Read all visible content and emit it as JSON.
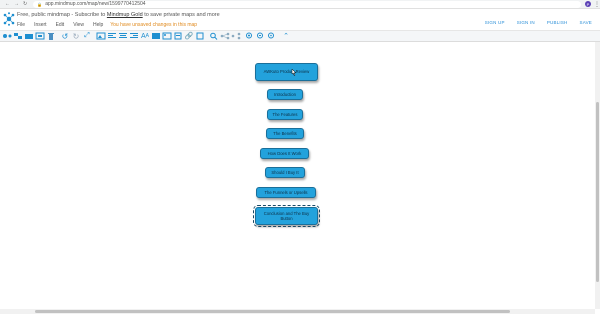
{
  "browser": {
    "url": "app.mindmup.com/map/new/1599770412504",
    "profile_initial": "P"
  },
  "header": {
    "banner_prefix": "Free, public mindmap - Subscribe to",
    "banner_link": "Mindmup Gold",
    "banner_suffix": "to save private maps and more",
    "menu": [
      "File",
      "Insert",
      "Edit",
      "View",
      "Help"
    ],
    "warning": "You have unsaved changes in this map",
    "actions": [
      "SIGN UP",
      "SIGN IN",
      "PUBLISH",
      "SAVE"
    ]
  },
  "toolbar": {
    "tools": [
      "add-child",
      "add-sibling",
      "add-parent",
      "group",
      "delete",
      "undo",
      "redo",
      "resize",
      "insert-image",
      "align-left",
      "align-center",
      "align-right",
      "text-size",
      "font",
      "image",
      "attachment",
      "link",
      "note",
      "search",
      "connect",
      "share",
      "zoom-in",
      "zoom-out",
      "zoom-reset",
      "collapse"
    ]
  },
  "mindmap": {
    "nodes": [
      {
        "label": "AWKuto Product Review",
        "selected": false
      },
      {
        "label": "Introduction",
        "selected": false
      },
      {
        "label": "The Features",
        "selected": false
      },
      {
        "label": "The Benefits",
        "selected": false
      },
      {
        "label": "How Does It Work",
        "selected": false
      },
      {
        "label": "Should I Buy It",
        "selected": false
      },
      {
        "label": "The Funnels or Upsells",
        "selected": false
      },
      {
        "label": "Conclusion and The Buy Button",
        "selected": true
      }
    ]
  },
  "colors": {
    "node_fill": "#23a2dc",
    "accent": "#2b8fd8",
    "warning": "#e08a1e"
  }
}
